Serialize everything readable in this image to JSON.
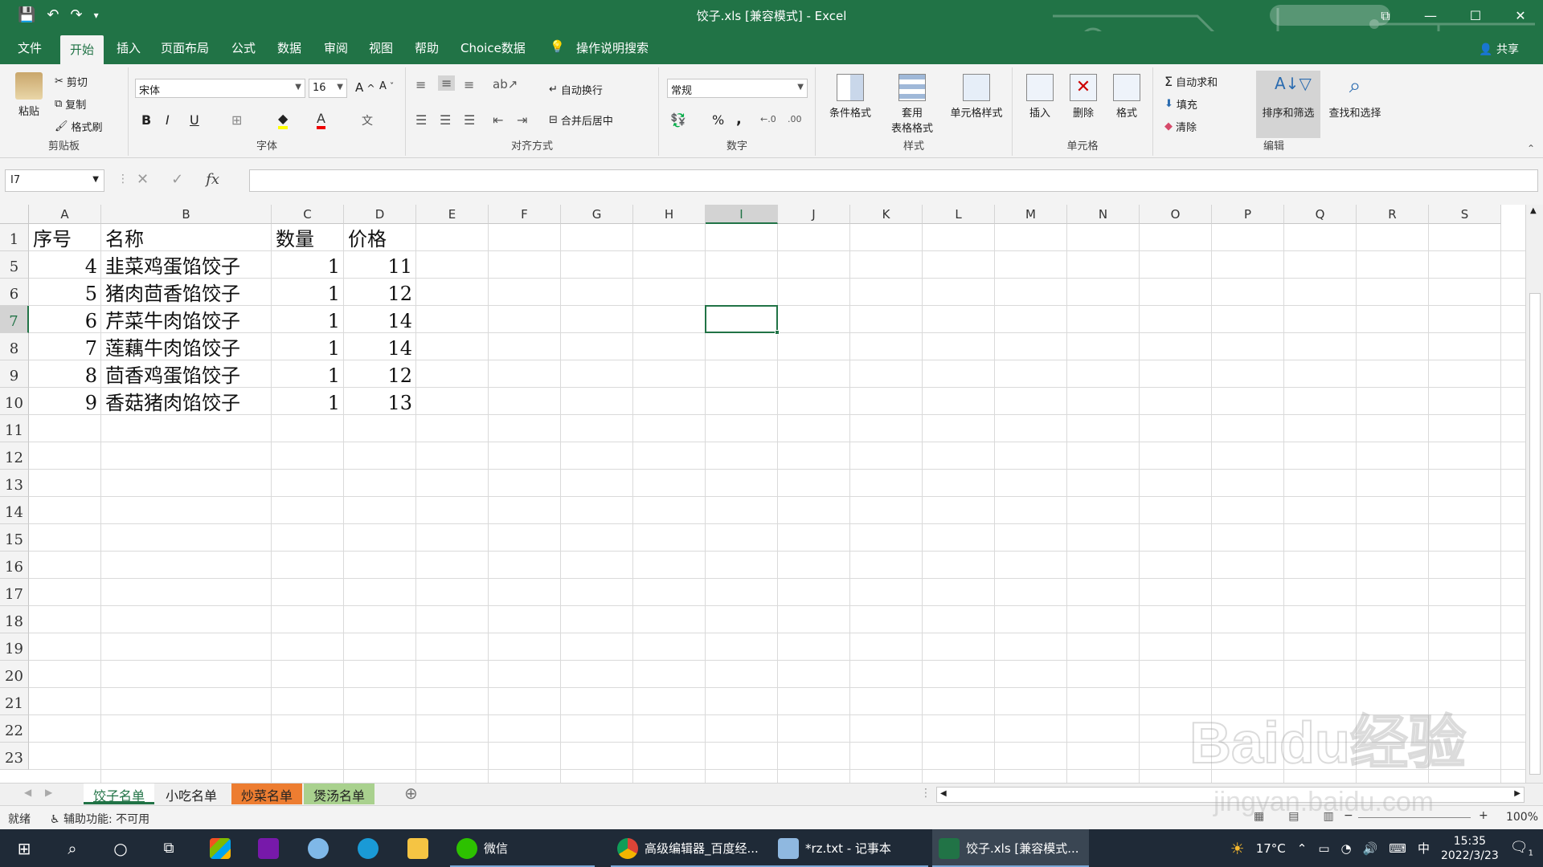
{
  "window": {
    "title": "饺子.xls [兼容模式] - Excel",
    "controls": {
      "restore": "⧉",
      "minimize": "—",
      "maximize": "☐",
      "close": "✕"
    }
  },
  "ribbon_tabs": [
    "文件",
    "开始",
    "插入",
    "页面布局",
    "公式",
    "数据",
    "审阅",
    "视图",
    "帮助",
    "Choice数据",
    "操作说明搜索"
  ],
  "active_tab": "开始",
  "share_label": "共享",
  "clipboard": {
    "paste": "粘贴",
    "cut": "剪切",
    "copy": "复制",
    "format_painter": "格式刷",
    "group": "剪贴板"
  },
  "font": {
    "name": "宋体",
    "size": "16",
    "group": "字体",
    "bold": "B",
    "italic": "I",
    "underline": "U"
  },
  "alignment": {
    "wrap": "自动换行",
    "merge": "合并后居中",
    "group": "对齐方式"
  },
  "number": {
    "format": "常规",
    "group": "数字",
    "percent": "%",
    "comma": ","
  },
  "styles": {
    "conditional": "条件格式",
    "table1": "套用",
    "table2": "表格格式",
    "cell_styles": "单元格样式",
    "group": "样式"
  },
  "cells": {
    "insert": "插入",
    "delete": "删除",
    "format": "格式",
    "group": "单元格"
  },
  "editing": {
    "autosum": "自动求和",
    "fill": "填充",
    "clear": "清除",
    "sort": "排序和筛选",
    "find": "查找和选择",
    "group": "编辑"
  },
  "formula_bar": {
    "name_box": "I7",
    "fx": "fx",
    "value": ""
  },
  "columns": [
    "A",
    "B",
    "C",
    "D",
    "E",
    "F",
    "G",
    "H",
    "I",
    "J",
    "K",
    "L",
    "M",
    "N",
    "O",
    "P",
    "Q",
    "R",
    "S"
  ],
  "selected_column": "I",
  "row_numbers": [
    "1",
    "5",
    "6",
    "7",
    "8",
    "9",
    "10",
    "11",
    "12",
    "13",
    "14",
    "15",
    "16",
    "17",
    "18",
    "19",
    "20",
    "21",
    "22",
    "23"
  ],
  "selected_row": "7",
  "table": {
    "header": [
      "序号",
      "名称",
      "数量",
      "价格"
    ],
    "rows": [
      [
        "4",
        "韭菜鸡蛋馅饺子",
        "1",
        "11"
      ],
      [
        "5",
        "猪肉茴香馅饺子",
        "1",
        "12"
      ],
      [
        "6",
        "芹菜牛肉馅饺子",
        "1",
        "14"
      ],
      [
        "7",
        "莲藕牛肉馅饺子",
        "1",
        "14"
      ],
      [
        "8",
        "茴香鸡蛋馅饺子",
        "1",
        "12"
      ],
      [
        "9",
        "香菇猪肉馅饺子",
        "1",
        "13"
      ]
    ]
  },
  "sheets": [
    {
      "name": "饺子名单",
      "color": "#ffffff"
    },
    {
      "name": "小吃名单",
      "color": "#f0f0f0"
    },
    {
      "name": "炒菜名单",
      "color": "#ed7d31"
    },
    {
      "name": "煲汤名单",
      "color": "#a9d18e"
    }
  ],
  "status": {
    "ready": "就绪",
    "accessibility": "辅助功能: 不可用",
    "zoom": "100%"
  },
  "taskbar": {
    "items": [
      "微信",
      "高级编辑器_百度经...",
      "*rz.txt - 记事本",
      "饺子.xls [兼容模式..."
    ],
    "temperature": "17°C",
    "ime": "中",
    "time": "15:35",
    "date": "2022/3/23",
    "notifications": "1"
  },
  "watermark": {
    "brand": "Baidu经验",
    "url": "jingyan.baidu.com"
  },
  "colors": {
    "excel_green": "#217346",
    "taskbar": "#1f2a37"
  }
}
